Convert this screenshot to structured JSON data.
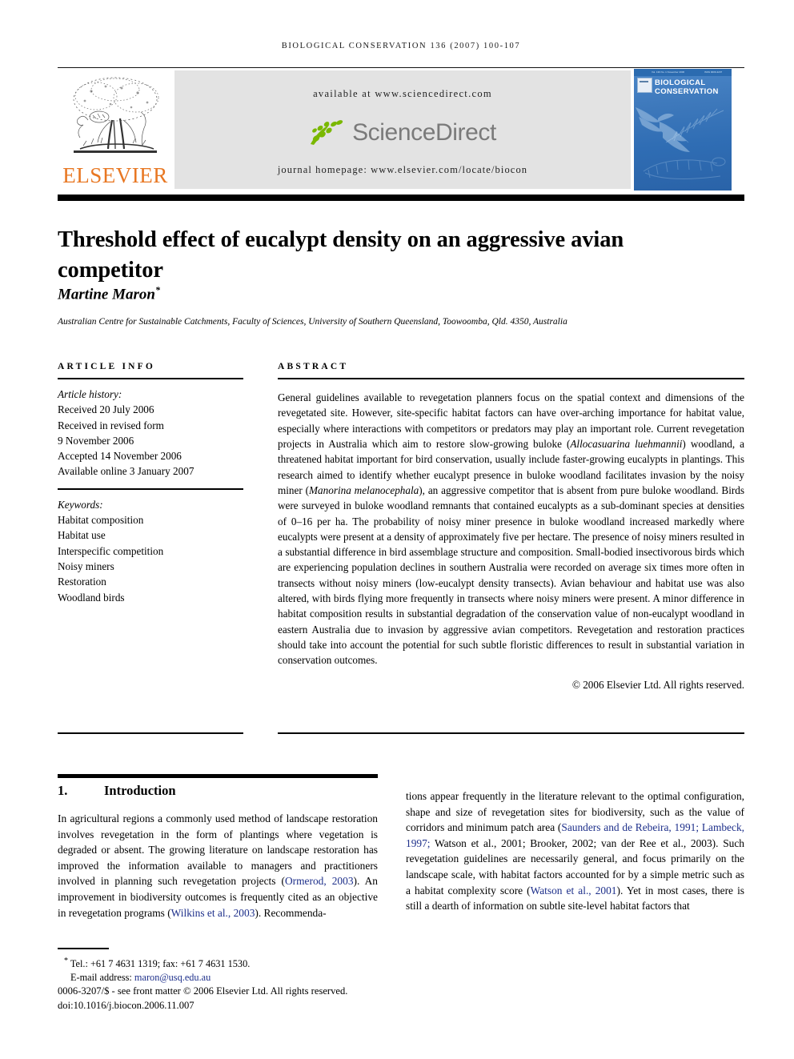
{
  "running_head": "BIOLOGICAL CONSERVATION 136 (2007) 100-107",
  "banner": {
    "publisher_name": "ELSEVIER",
    "available_at": "available at www.sciencedirect.com",
    "sciencedirect_wordmark": "ScienceDirect",
    "journal_homepage": "journal homepage: www.elsevier.com/locate/biocon",
    "cover": {
      "journal_line1": "BIOLOGICAL",
      "journal_line2": "CONSERVATION",
      "masthead_left": "Vol. 136  No. 1  November 2006",
      "masthead_right": "ISSN 0006-3207"
    },
    "colors": {
      "elsevier_orange": "#E87722",
      "sciencedirect_green": "#7AB800",
      "sciencedirect_gray": "#7a7a7a",
      "banner_background": "#e3e3e3",
      "cover_blue": "#3d78bb"
    }
  },
  "article": {
    "title": "Threshold effect of eucalypt density on an aggressive avian competitor",
    "author": "Martine Maron",
    "author_marker": "*",
    "affiliation": "Australian Centre for Sustainable Catchments, Faculty of Sciences, University of Southern Queensland, Toowoomba, Qld. 4350, Australia"
  },
  "article_info": {
    "heading": "ARTICLE INFO",
    "history_label": "Article history:",
    "history": [
      "Received 20 July 2006",
      "Received in revised form",
      "9 November 2006",
      "Accepted 14 November 2006",
      "Available online 3 January 2007"
    ],
    "keywords_label": "Keywords:",
    "keywords": [
      "Habitat composition",
      "Habitat use",
      "Interspecific competition",
      "Noisy miners",
      "Restoration",
      "Woodland birds"
    ]
  },
  "abstract": {
    "heading": "ABSTRACT",
    "part1": "General guidelines available to revegetation planners focus on the spatial context and dimensions of the revegetated site. However, site-specific habitat factors can have over-arching importance for habitat value, especially where interactions with competitors or predators may play an important role. Current revegetation projects in Australia which aim to restore slow-growing buloke (",
    "species1": "Allocasuarina luehmannii",
    "part2": ") woodland, a threatened habitat important for bird conservation, usually include faster-growing eucalypts in plantings. This research aimed to identify whether eucalypt presence in buloke woodland facilitates invasion by the noisy miner (",
    "species2": "Manorina melanocephala",
    "part3": "), an aggressive competitor that is absent from pure buloke woodland. Birds were surveyed in buloke woodland remnants that contained eucalypts as a sub-dominant species at densities of 0–16 per ha. The probability of noisy miner presence in buloke woodland increased markedly where eucalypts were present at a density of approximately five per hectare. The presence of noisy miners resulted in a substantial difference in bird assemblage structure and composition. Small-bodied insectivorous birds which are experiencing population declines in southern Australia were recorded on average six times more often in transects without noisy miners (low-eucalypt density transects). Avian behaviour and habitat use was also altered, with birds flying more frequently in transects where noisy miners were present. A minor difference in habitat composition results in substantial degradation of the conservation value of non-eucalypt woodland in eastern Australia due to invasion by aggressive avian competitors. Revegetation and restoration practices should take into account the potential for such subtle floristic differences to result in substantial variation in conservation outcomes.",
    "copyright": "© 2006 Elsevier Ltd. All rights reserved."
  },
  "introduction": {
    "number": "1.",
    "title": "Introduction",
    "left_column": {
      "seg1": "In agricultural regions a commonly used method of landscape restoration involves revegetation in the form of plantings where vegetation is degraded or absent. The growing literature on landscape restoration has improved the information available to managers and practitioners involved in planning such revegetation projects (",
      "cite1": "Ormerod, 2003",
      "seg2": "). An improvement in biodiversity outcomes is frequently cited as an objective in revegetation programs (",
      "cite2": "Wilkins et al., 2003",
      "seg3": "). Recommenda-"
    },
    "right_column": {
      "seg1": "tions appear frequently in the literature relevant to the optimal configuration, shape and size of revegetation sites for biodiversity, such as the value of corridors and minimum patch area (",
      "cite1": "Saunders and de Rebeira, 1991; Lambeck, 1997;",
      "seg2": " Watson et al., 2001; Brooker, 2002; van der Ree et al., 2003). Such revegetation guidelines are necessarily general, and focus primarily on the landscape scale, with habitat factors accounted for by a simple metric such as a habitat complexity score (",
      "cite2": "Watson et al., 2001",
      "seg3": "). Yet in most cases, there is still a dearth of information on subtle site-level habitat factors that"
    }
  },
  "footnotes": {
    "corresponding": "Tel.: +61 7 4631 1319; fax: +61 7 4631 1530.",
    "email_label": "E-mail address:",
    "email": "maron@usq.edu.au",
    "front_matter": "0006-3207/$ - see front matter © 2006 Elsevier Ltd. All rights reserved.",
    "doi": "doi:10.1016/j.biocon.2006.11.007"
  }
}
